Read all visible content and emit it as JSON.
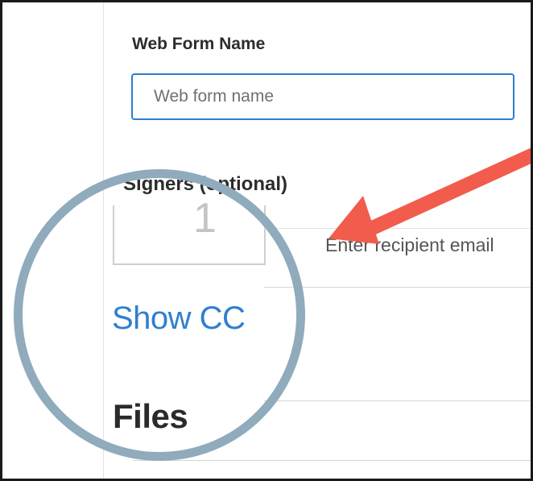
{
  "form": {
    "name_label": "Web Form Name",
    "name_placeholder": "Web form name",
    "name_value": ""
  },
  "signers": {
    "label": "Signers (optional)",
    "order_number": "1",
    "email_placeholder": "Enter recipient email",
    "email_value": ""
  },
  "cc": {
    "show_label": "Show CC"
  },
  "files": {
    "heading": "Files"
  },
  "annotation": {
    "arrow_color": "#f25c4d",
    "magnifier_ring_color": "#8fabbc"
  },
  "colors": {
    "accent": "#2d7ed1",
    "link": "#2f7fd1"
  }
}
